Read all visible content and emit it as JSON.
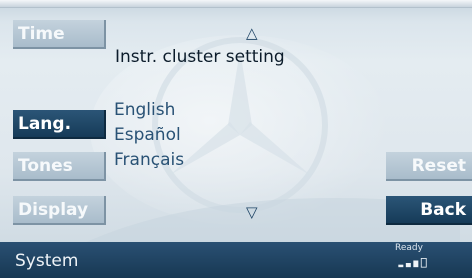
{
  "left_menu": {
    "time": "Time",
    "lang": "Lang.",
    "tones": "Tones",
    "display": "Display"
  },
  "right_menu": {
    "reset": "Reset",
    "back": "Back"
  },
  "main": {
    "heading": "Instr. cluster setting",
    "languages": [
      "English",
      "Español",
      "Français"
    ],
    "selected_menu": "Lang."
  },
  "status_bar": {
    "title": "System",
    "ready_label": "Ready",
    "signal_level": 3
  },
  "colors": {
    "accent_dark_blue": "#1c4566",
    "button_light": "#b7c8d5",
    "text_blue": "#295275"
  },
  "icons": {
    "scroll_up": "triangle-up-icon",
    "scroll_down": "triangle-down-icon",
    "signal": "signal-strength-icon",
    "background": "star-emblem-watermark"
  }
}
